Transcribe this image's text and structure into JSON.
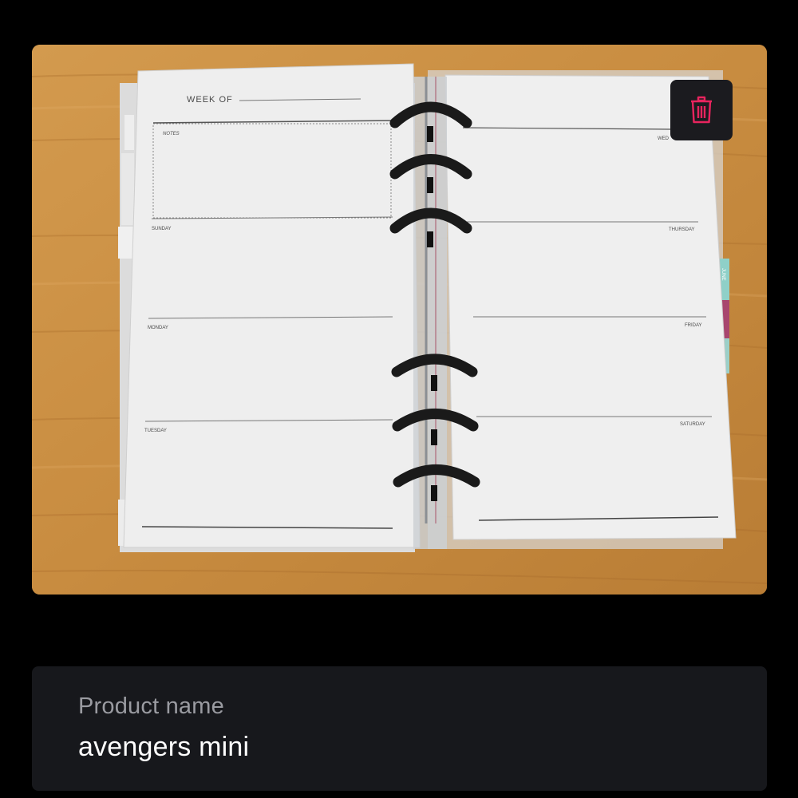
{
  "image": {
    "description_icon": "planner-photo",
    "page_labels": {
      "week_of": "WEEK OF",
      "notes": "NOTES",
      "sunday": "SUNDAY",
      "monday": "MONDAY",
      "tuesday": "TUESDAY",
      "wednesday": "WED",
      "thursday": "THURSDAY",
      "friday": "FRIDAY",
      "saturday": "SATURDAY",
      "tab_june": "JUNE"
    }
  },
  "delete": {
    "icon": "trash-icon",
    "color": "#e8245e"
  },
  "product": {
    "label": "Product name",
    "value": "avengers mini"
  },
  "colors": {
    "background": "#000000",
    "card": "#17181c",
    "label": "#9a9ba1",
    "value": "#ffffff"
  }
}
